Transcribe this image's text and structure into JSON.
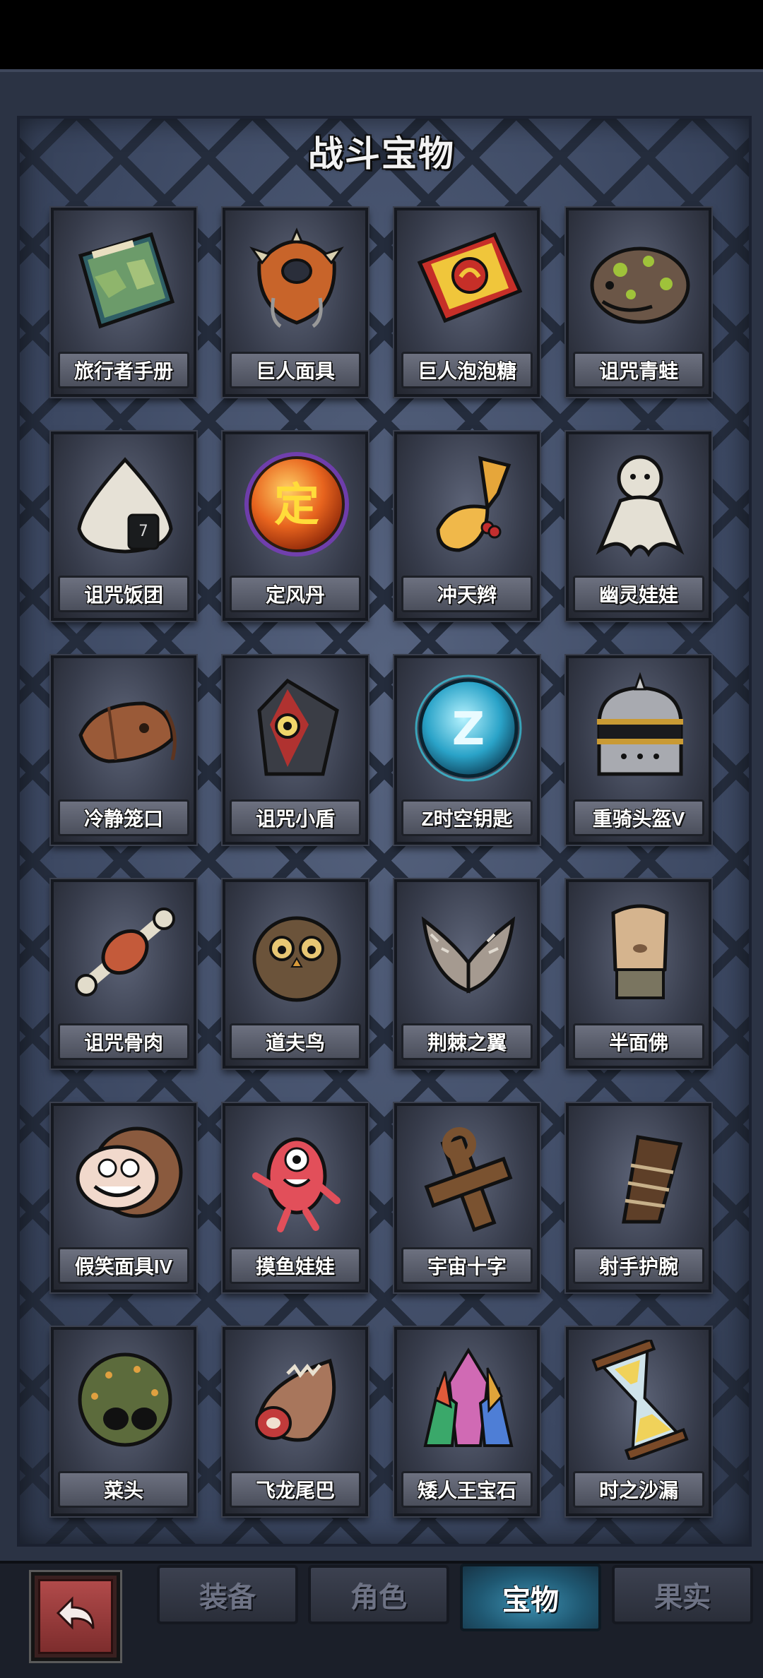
{
  "title": "战斗宝物",
  "items": [
    {
      "label": "旅行者手册",
      "icon": "traveler-handbook-icon"
    },
    {
      "label": "巨人面具",
      "icon": "giant-mask-icon"
    },
    {
      "label": "巨人泡泡糖",
      "icon": "giant-bubblegum-icon"
    },
    {
      "label": "诅咒青蛙",
      "icon": "cursed-frog-icon"
    },
    {
      "label": "诅咒饭团",
      "icon": "cursed-rice-ball-icon"
    },
    {
      "label": "定风丹",
      "icon": "wind-calming-pill-icon",
      "glyph": "定"
    },
    {
      "label": "冲天辫",
      "icon": "ponytail-icon"
    },
    {
      "label": "幽灵娃娃",
      "icon": "ghost-doll-icon"
    },
    {
      "label": "冷静笼口",
      "icon": "calm-muzzle-icon"
    },
    {
      "label": "诅咒小盾",
      "icon": "cursed-shield-icon"
    },
    {
      "label": "Z时空钥匙",
      "icon": "z-space-time-key-icon",
      "glyph": "Z"
    },
    {
      "label": "重骑头盔V",
      "icon": "heavy-knight-helmet-icon"
    },
    {
      "label": "诅咒骨肉",
      "icon": "cursed-bone-meat-icon"
    },
    {
      "label": "道夫鸟",
      "icon": "dodo-bird-icon"
    },
    {
      "label": "荆棘之翼",
      "icon": "thorn-wings-icon"
    },
    {
      "label": "半面佛",
      "icon": "half-face-buddha-icon"
    },
    {
      "label": "假笑面具IV",
      "icon": "fake-smile-mask-icon"
    },
    {
      "label": "摸鱼娃娃",
      "icon": "slacker-doll-icon"
    },
    {
      "label": "宇宙十字",
      "icon": "cosmic-cross-icon"
    },
    {
      "label": "射手护腕",
      "icon": "archer-bracer-icon"
    },
    {
      "label": "菜头",
      "icon": "veggie-head-icon"
    },
    {
      "label": "飞龙尾巴",
      "icon": "wyvern-tail-icon"
    },
    {
      "label": "矮人王宝石",
      "icon": "dwarf-king-gem-icon"
    },
    {
      "label": "时之沙漏",
      "icon": "hourglass-of-time-icon"
    }
  ],
  "tabs": [
    {
      "label": "装备",
      "active": false
    },
    {
      "label": "角色",
      "active": false
    },
    {
      "label": "宝物",
      "active": true
    },
    {
      "label": "果实",
      "active": false
    }
  ],
  "back_button": {
    "icon": "return-arrow-icon"
  }
}
